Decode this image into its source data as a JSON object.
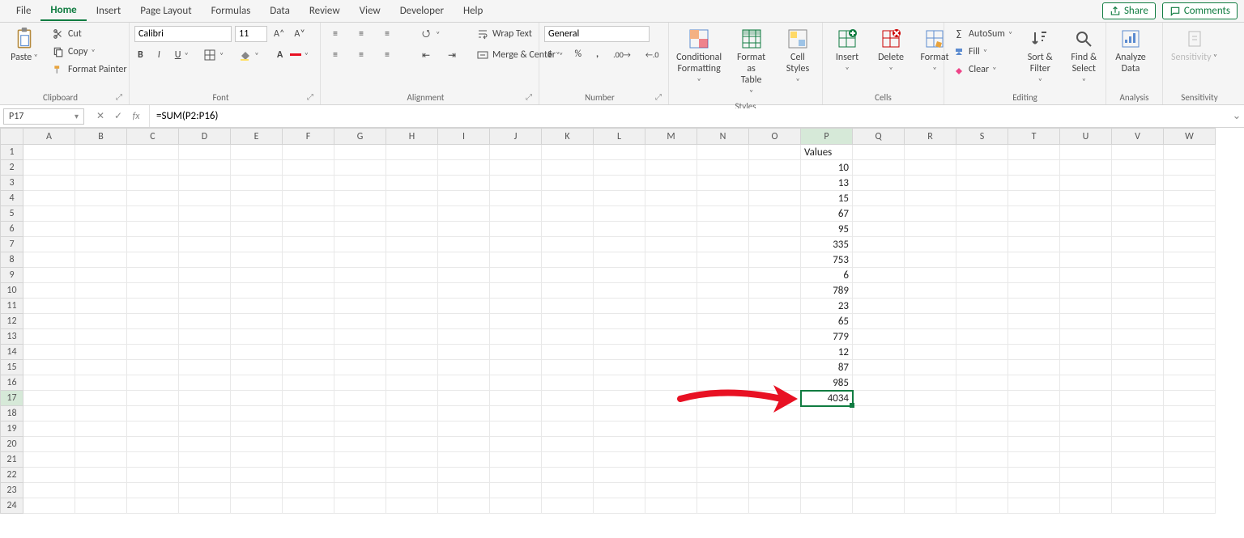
{
  "tabs": {
    "items": [
      "File",
      "Home",
      "Insert",
      "Page Layout",
      "Formulas",
      "Data",
      "Review",
      "View",
      "Developer",
      "Help"
    ],
    "active": "Home",
    "share": "Share",
    "comments": "Comments"
  },
  "ribbon": {
    "clipboard": {
      "label": "Clipboard",
      "paste": "Paste",
      "cut": "Cut",
      "copy": "Copy",
      "format_painter": "Format Painter"
    },
    "font": {
      "label": "Font",
      "name": "Calibri",
      "size": "11"
    },
    "alignment": {
      "label": "Alignment",
      "wrap": "Wrap Text",
      "merge": "Merge & Center"
    },
    "number": {
      "label": "Number",
      "format": "General"
    },
    "styles": {
      "label": "Styles",
      "cond": "Conditional\nFormatting",
      "table": "Format as\nTable",
      "cell": "Cell\nStyles"
    },
    "cells": {
      "label": "Cells",
      "insert": "Insert",
      "delete": "Delete",
      "format": "Format"
    },
    "editing": {
      "label": "Editing",
      "autosum": "AutoSum",
      "fill": "Fill",
      "clear": "Clear",
      "sort": "Sort &\nFilter",
      "find": "Find &\nSelect"
    },
    "analysis": {
      "label": "Analysis",
      "analyze": "Analyze\nData"
    },
    "sensitivity": {
      "label": "Sensitivity",
      "btn": "Sensitivity"
    }
  },
  "formula_bar": {
    "name_box": "P17",
    "formula": "=SUM(P2:P16)"
  },
  "sheet": {
    "columns": [
      "A",
      "B",
      "C",
      "D",
      "E",
      "F",
      "G",
      "H",
      "I",
      "J",
      "K",
      "L",
      "M",
      "N",
      "O",
      "P",
      "Q",
      "R",
      "S",
      "T",
      "U",
      "V",
      "W"
    ],
    "row_count": 24,
    "selected_cell": {
      "col": "P",
      "row": 17
    },
    "data": {
      "P1": "Values",
      "P2": "10",
      "P3": "13",
      "P4": "15",
      "P5": "67",
      "P6": "95",
      "P7": "335",
      "P8": "753",
      "P9": "6",
      "P10": "789",
      "P11": "23",
      "P12": "65",
      "P13": "779",
      "P14": "12",
      "P15": "87",
      "P16": "985",
      "P17": "4034"
    }
  }
}
